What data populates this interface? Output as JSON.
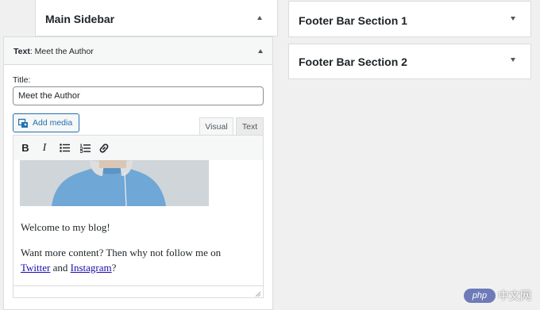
{
  "widget_areas": {
    "main_sidebar": "Main Sidebar",
    "footer_1": "Footer Bar Section 1",
    "footer_2": "Footer Bar Section 2"
  },
  "widget": {
    "type_label": "Text",
    "name": ": Meet the Author",
    "title_label": "Title:",
    "title_value": "Meet the Author"
  },
  "editor": {
    "add_media_label": "Add media",
    "tab_visual": "Visual",
    "tab_text": "Text",
    "toolbar": [
      "bold-icon",
      "italic-icon",
      "bullet-list-icon",
      "numbered-list-icon",
      "link-icon"
    ],
    "paragraph_1": "Welcome to my blog!",
    "paragraph_2_start": "Want more content? Then why not follow me on",
    "link_1": "Twitter",
    "conjunction": " and ",
    "link_2": "Instagram",
    "paragraph_2_end": "?"
  },
  "watermark": {
    "logo_text": "php",
    "text": "中文网"
  }
}
